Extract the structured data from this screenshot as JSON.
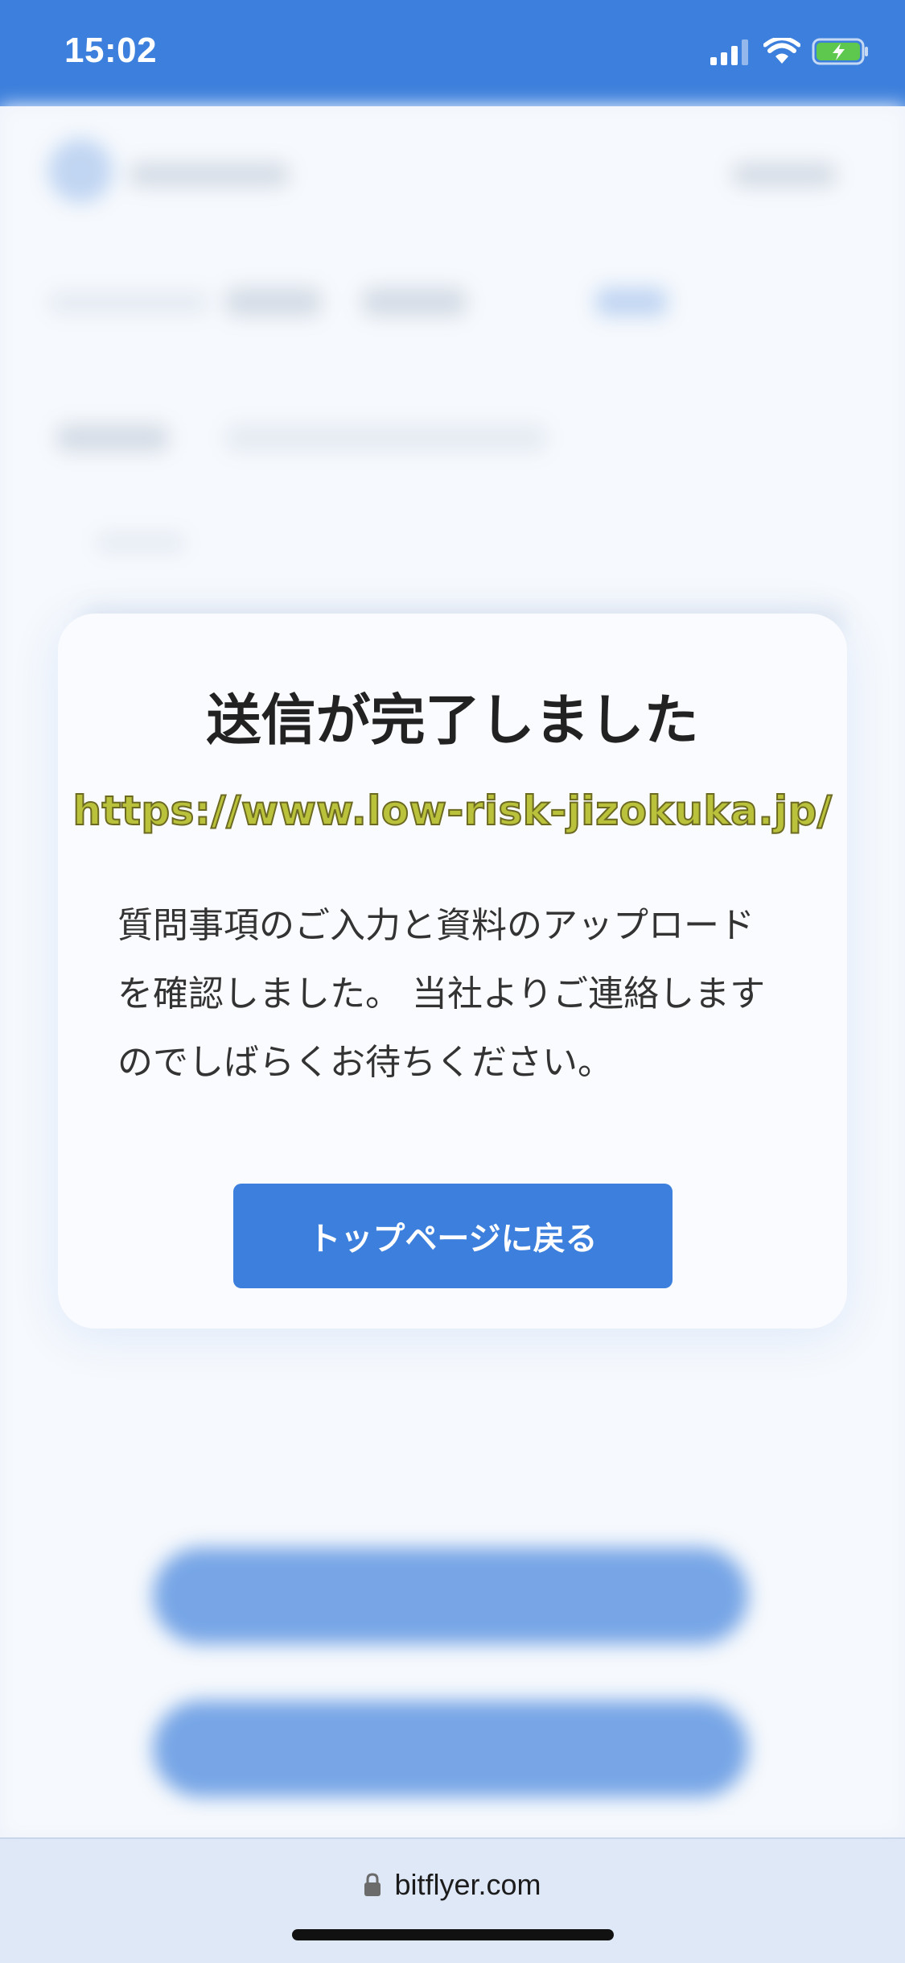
{
  "status_bar": {
    "time": "15:02",
    "icons": [
      "signal-icon",
      "wifi-icon",
      "battery-charging-icon"
    ]
  },
  "modal": {
    "title": "送信が完了しました",
    "watermark": "https://www.low-risk-jizokuka.jp/",
    "message": "質問事項のご入力と資料のアップロード\nを確認しました。 当社よりご連絡します\nのでしばらくお待ちください。",
    "button_label": "トップページに戻る"
  },
  "url_bar": {
    "domain": "bitflyer.com",
    "icon": "lock-icon"
  },
  "colors": {
    "accent": "#3c7fdc",
    "watermark": "#b9c23a",
    "battery": "#5ec84e"
  }
}
